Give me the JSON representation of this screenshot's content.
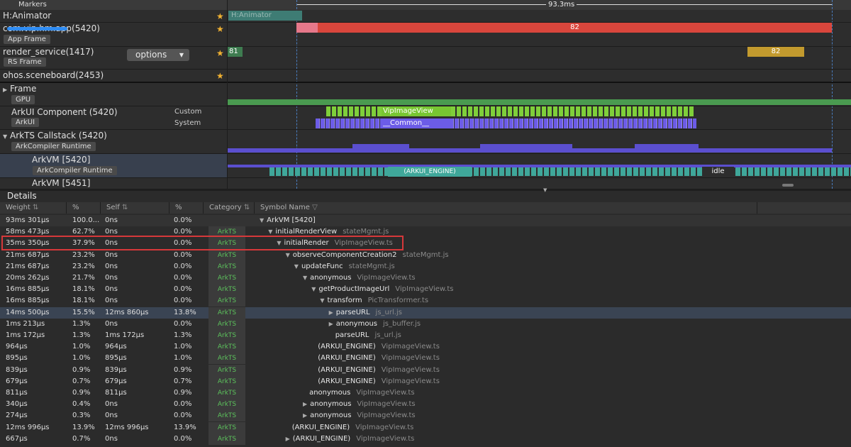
{
  "timeline": {
    "markers_label": "Markers",
    "range_label": "93.3ms",
    "options_button": "options",
    "rows": [
      {
        "label": "H:Animator",
        "block": "H:Animator"
      },
      {
        "label": "com.vip.hm.app(5420)",
        "tag": "App Frame",
        "block": "82"
      },
      {
        "label": "render_service(1417)",
        "tag": "RS Frame",
        "block_left": "81",
        "block": "82"
      },
      {
        "label": "ohos.sceneboard(2453)"
      }
    ],
    "frame": {
      "label": "Frame",
      "tag": "GPU"
    },
    "arkui": {
      "label": "ArkUI Component (5420)",
      "tag": "ArkUI",
      "custom": "Custom",
      "system": "System",
      "block1": "VipImageView",
      "block2": "__Common__"
    },
    "arkts": {
      "label": "ArkTS Callstack (5420)",
      "tag": "ArkCompiler Runtime"
    },
    "arkvm": {
      "label": "ArkVM [5420]",
      "tag": "ArkCompiler Runtime",
      "engine": "(ARKUI_ENGINE)",
      "idle": "idle"
    },
    "arkvm2": {
      "label": "ArkVM [5451]"
    }
  },
  "details": {
    "title": "Details",
    "headers": [
      "Weight",
      "%",
      "Self",
      "%",
      "Category",
      "Symbol Name"
    ],
    "rows": [
      {
        "w": "93ms 301μs",
        "p": "100.0...",
        "s": "0ns",
        "sp": "0.0%",
        "cat": "",
        "sym": "ArkVM [5420]",
        "file": "",
        "d": 0,
        "tri": "▼"
      },
      {
        "w": "58ms 473μs",
        "p": "62.7%",
        "s": "0ns",
        "sp": "0.0%",
        "cat": "ArkTS",
        "sym": "initialRenderView",
        "file": "stateMgmt.js",
        "d": 1,
        "tri": "▼"
      },
      {
        "w": "35ms 350μs",
        "p": "37.9%",
        "s": "0ns",
        "sp": "0.0%",
        "cat": "ArkTS",
        "sym": "initialRender",
        "file": "VipImageView.ts",
        "d": 2,
        "tri": "▼"
      },
      {
        "w": "21ms 687μs",
        "p": "23.2%",
        "s": "0ns",
        "sp": "0.0%",
        "cat": "ArkTS",
        "sym": "observeComponentCreation2",
        "file": "stateMgmt.js",
        "d": 3,
        "tri": "▼"
      },
      {
        "w": "21ms 687μs",
        "p": "23.2%",
        "s": "0ns",
        "sp": "0.0%",
        "cat": "ArkTS",
        "sym": "updateFunc",
        "file": "stateMgmt.js",
        "d": 4,
        "tri": "▼"
      },
      {
        "w": "20ms 262μs",
        "p": "21.7%",
        "s": "0ns",
        "sp": "0.0%",
        "cat": "ArkTS",
        "sym": "anonymous",
        "file": "VipImageView.ts",
        "d": 5,
        "tri": "▼"
      },
      {
        "w": "16ms 885μs",
        "p": "18.1%",
        "s": "0ns",
        "sp": "0.0%",
        "cat": "ArkTS",
        "sym": "getProductImageUrl",
        "file": "VipImageView.ts",
        "d": 6,
        "tri": "▼"
      },
      {
        "w": "16ms 885μs",
        "p": "18.1%",
        "s": "0ns",
        "sp": "0.0%",
        "cat": "ArkTS",
        "sym": "transform",
        "file": "PicTransformer.ts",
        "d": 7,
        "tri": "▼"
      },
      {
        "w": "14ms 500μs",
        "p": "15.5%",
        "s": "12ms 860μs",
        "sp": "13.8%",
        "cat": "ArkTS",
        "sym": "parseURL",
        "file": "js_url.js",
        "d": 8,
        "tri": "▶"
      },
      {
        "w": "1ms 213μs",
        "p": "1.3%",
        "s": "0ns",
        "sp": "0.0%",
        "cat": "ArkTS",
        "sym": "anonymous",
        "file": "js_buffer.js",
        "d": 8,
        "tri": "▶"
      },
      {
        "w": "1ms 172μs",
        "p": "1.3%",
        "s": "1ms 172μs",
        "sp": "1.3%",
        "cat": "ArkTS",
        "sym": "parseURL",
        "file": "js_url.js",
        "d": 8,
        "tri": ""
      },
      {
        "w": "964μs",
        "p": "1.0%",
        "s": "964μs",
        "sp": "1.0%",
        "cat": "ArkTS",
        "sym": "(ARKUI_ENGINE)",
        "file": "VipImageView.ts",
        "d": 6,
        "tri": ""
      },
      {
        "w": "895μs",
        "p": "1.0%",
        "s": "895μs",
        "sp": "1.0%",
        "cat": "ArkTS",
        "sym": "(ARKUI_ENGINE)",
        "file": "VipImageView.ts",
        "d": 6,
        "tri": ""
      },
      {
        "w": "839μs",
        "p": "0.9%",
        "s": "839μs",
        "sp": "0.9%",
        "cat": "ArkTS",
        "sym": "(ARKUI_ENGINE)",
        "file": "VipImageView.ts",
        "d": 6,
        "tri": ""
      },
      {
        "w": "679μs",
        "p": "0.7%",
        "s": "679μs",
        "sp": "0.7%",
        "cat": "ArkTS",
        "sym": "(ARKUI_ENGINE)",
        "file": "VipImageView.ts",
        "d": 6,
        "tri": ""
      },
      {
        "w": "811μs",
        "p": "0.9%",
        "s": "811μs",
        "sp": "0.9%",
        "cat": "ArkTS",
        "sym": "anonymous",
        "file": "VipImageView.ts",
        "d": 5,
        "tri": ""
      },
      {
        "w": "340μs",
        "p": "0.4%",
        "s": "0ns",
        "sp": "0.0%",
        "cat": "ArkTS",
        "sym": "anonymous",
        "file": "VipImageView.ts",
        "d": 5,
        "tri": "▶"
      },
      {
        "w": "274μs",
        "p": "0.3%",
        "s": "0ns",
        "sp": "0.0%",
        "cat": "ArkTS",
        "sym": "anonymous",
        "file": "VipImageView.ts",
        "d": 5,
        "tri": "▶"
      },
      {
        "w": "12ms 996μs",
        "p": "13.9%",
        "s": "12ms 996μs",
        "sp": "13.9%",
        "cat": "ArkTS",
        "sym": "(ARKUI_ENGINE)",
        "file": "VipImageView.ts",
        "d": 3,
        "tri": ""
      },
      {
        "w": "667μs",
        "p": "0.7%",
        "s": "0ns",
        "sp": "0.0%",
        "cat": "ArkTS",
        "sym": "(ARKUI_ENGINE)",
        "file": "VipImageView.ts",
        "d": 3,
        "tri": "▶"
      }
    ]
  }
}
